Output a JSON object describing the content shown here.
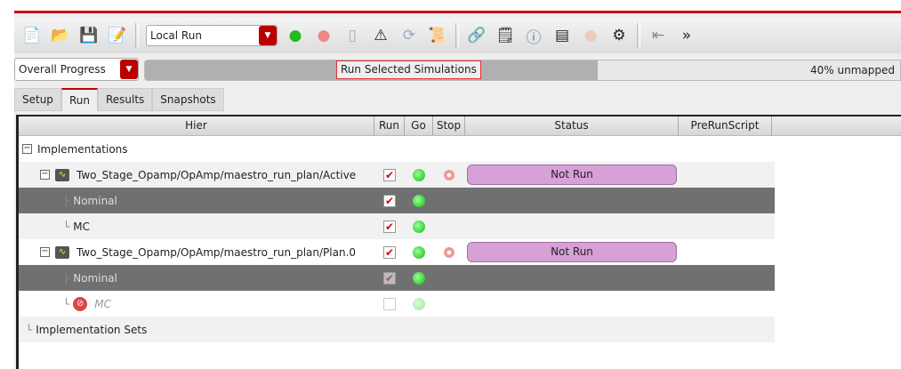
{
  "toolbar": {
    "run_mode": "Local Run",
    "overflow": "»"
  },
  "progress": {
    "selector": "Overall Progress",
    "tooltip": "Run Selected Simulations",
    "text": "40% unmapped",
    "fill_percent": 60
  },
  "tabs": [
    "Setup",
    "Run",
    "Results",
    "Snapshots"
  ],
  "active_tab": "Run",
  "columns": [
    "Hier",
    "Run",
    "Go",
    "Stop",
    "Status",
    "PreRunScript"
  ],
  "rows": {
    "implementations": "Implementations",
    "active": {
      "label": "Two_Stage_Opamp/OpAmp/maestro_run_plan/Active",
      "status": "Not Run"
    },
    "active_nominal": "Nominal",
    "active_mc": "MC",
    "plan0": {
      "label": "Two_Stage_Opamp/OpAmp/maestro_run_plan/Plan.0",
      "status": "Not Run"
    },
    "plan0_nominal": "Nominal",
    "plan0_mc": "MC",
    "implementation_sets": "Implementation Sets"
  },
  "icons": {
    "check": "✔",
    "expand": "−"
  }
}
